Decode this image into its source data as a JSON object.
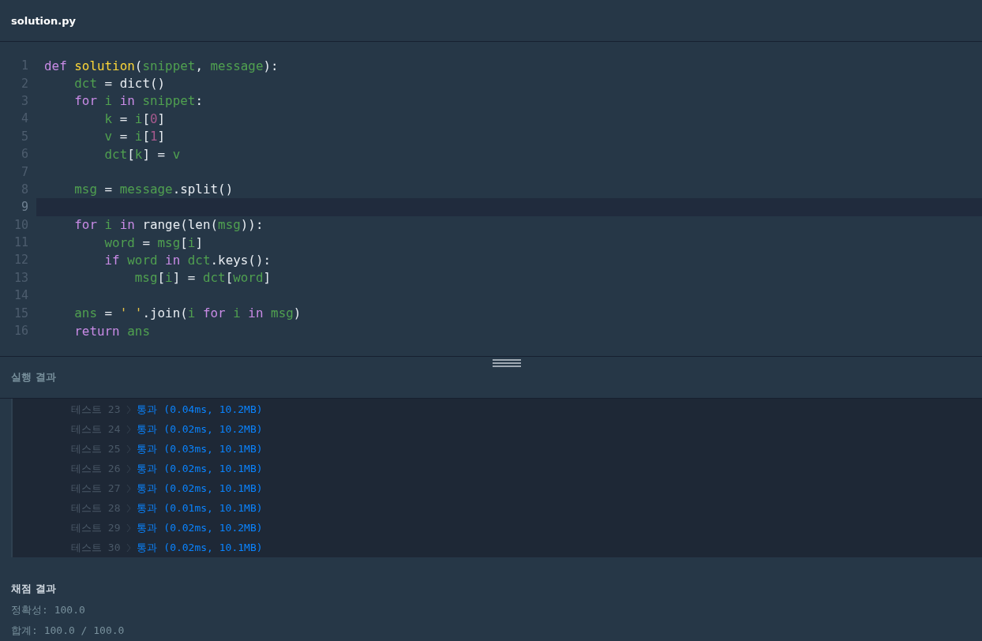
{
  "file_tab": {
    "title": "solution.py"
  },
  "code": {
    "lines": [
      {
        "number": "1",
        "highlighted": false,
        "tokens": [
          {
            "kind": "kw",
            "text": "def "
          },
          {
            "kind": "fn",
            "text": "solution"
          },
          {
            "kind": "plain",
            "text": "("
          },
          {
            "kind": "var",
            "text": "snippet"
          },
          {
            "kind": "plain",
            "text": ", "
          },
          {
            "kind": "var",
            "text": "message"
          },
          {
            "kind": "plain",
            "text": "):"
          }
        ]
      },
      {
        "number": "2",
        "highlighted": false,
        "tokens": [
          {
            "kind": "var",
            "text": "    dct"
          },
          {
            "kind": "plain",
            "text": " = dict()"
          }
        ]
      },
      {
        "number": "3",
        "highlighted": false,
        "tokens": [
          {
            "kind": "kw",
            "text": "    for "
          },
          {
            "kind": "var",
            "text": "i "
          },
          {
            "kind": "kw",
            "text": "in "
          },
          {
            "kind": "var",
            "text": "snippet"
          },
          {
            "kind": "plain",
            "text": ":"
          }
        ]
      },
      {
        "number": "4",
        "highlighted": false,
        "tokens": [
          {
            "kind": "var",
            "text": "        k"
          },
          {
            "kind": "plain",
            "text": " = "
          },
          {
            "kind": "var",
            "text": "i"
          },
          {
            "kind": "plain",
            "text": "["
          },
          {
            "kind": "num",
            "text": "0"
          },
          {
            "kind": "plain",
            "text": "]"
          }
        ]
      },
      {
        "number": "5",
        "highlighted": false,
        "tokens": [
          {
            "kind": "var",
            "text": "        v"
          },
          {
            "kind": "plain",
            "text": " = "
          },
          {
            "kind": "var",
            "text": "i"
          },
          {
            "kind": "plain",
            "text": "["
          },
          {
            "kind": "num",
            "text": "1"
          },
          {
            "kind": "plain",
            "text": "]"
          }
        ]
      },
      {
        "number": "6",
        "highlighted": false,
        "tokens": [
          {
            "kind": "var",
            "text": "        dct"
          },
          {
            "kind": "plain",
            "text": "["
          },
          {
            "kind": "var",
            "text": "k"
          },
          {
            "kind": "plain",
            "text": "] = "
          },
          {
            "kind": "var",
            "text": "v"
          }
        ]
      },
      {
        "number": "7",
        "highlighted": false
      },
      {
        "number": "8",
        "highlighted": false,
        "tokens": [
          {
            "kind": "var",
            "text": "    msg"
          },
          {
            "kind": "plain",
            "text": " = "
          },
          {
            "kind": "var",
            "text": "message"
          },
          {
            "kind": "plain",
            "text": ".split()"
          }
        ]
      },
      {
        "number": "9",
        "highlighted": true
      },
      {
        "number": "10",
        "highlighted": false,
        "tokens": [
          {
            "kind": "kw",
            "text": "    for "
          },
          {
            "kind": "var",
            "text": "i "
          },
          {
            "kind": "kw",
            "text": "in "
          },
          {
            "kind": "plain",
            "text": "range(len("
          },
          {
            "kind": "var",
            "text": "msg"
          },
          {
            "kind": "plain",
            "text": ")):"
          }
        ]
      },
      {
        "number": "11",
        "highlighted": false,
        "tokens": [
          {
            "kind": "var",
            "text": "        word"
          },
          {
            "kind": "plain",
            "text": " = "
          },
          {
            "kind": "var",
            "text": "msg"
          },
          {
            "kind": "plain",
            "text": "["
          },
          {
            "kind": "var",
            "text": "i"
          },
          {
            "kind": "plain",
            "text": "]"
          }
        ]
      },
      {
        "number": "12",
        "highlighted": false,
        "tokens": [
          {
            "kind": "kw",
            "text": "        if "
          },
          {
            "kind": "var",
            "text": "word "
          },
          {
            "kind": "kw",
            "text": "in "
          },
          {
            "kind": "var",
            "text": "dct"
          },
          {
            "kind": "plain",
            "text": ".keys():"
          }
        ]
      },
      {
        "number": "13",
        "highlighted": false,
        "tokens": [
          {
            "kind": "var",
            "text": "            msg"
          },
          {
            "kind": "plain",
            "text": "["
          },
          {
            "kind": "var",
            "text": "i"
          },
          {
            "kind": "plain",
            "text": "] = "
          },
          {
            "kind": "var",
            "text": "dct"
          },
          {
            "kind": "plain",
            "text": "["
          },
          {
            "kind": "var",
            "text": "word"
          },
          {
            "kind": "plain",
            "text": "]"
          }
        ]
      },
      {
        "number": "14",
        "highlighted": false
      },
      {
        "number": "15",
        "highlighted": false,
        "tokens": [
          {
            "kind": "var",
            "text": "    ans"
          },
          {
            "kind": "plain",
            "text": " = "
          },
          {
            "kind": "str",
            "text": "' '"
          },
          {
            "kind": "plain",
            "text": ".join("
          },
          {
            "kind": "var",
            "text": "i "
          },
          {
            "kind": "kw",
            "text": "for "
          },
          {
            "kind": "var",
            "text": "i "
          },
          {
            "kind": "kw",
            "text": "in "
          },
          {
            "kind": "var",
            "text": "msg"
          },
          {
            "kind": "plain",
            "text": ")"
          }
        ]
      },
      {
        "number": "16",
        "highlighted": false,
        "tokens": [
          {
            "kind": "kw",
            "text": "    return "
          },
          {
            "kind": "var",
            "text": "ans"
          }
        ]
      }
    ]
  },
  "run_results": {
    "title": "실행 결과",
    "tests": [
      {
        "label": "테스트 23",
        "result": "통과 (0.04ms, 10.2MB)"
      },
      {
        "label": "테스트 24",
        "result": "통과 (0.02ms, 10.2MB)"
      },
      {
        "label": "테스트 25",
        "result": "통과 (0.03ms, 10.1MB)"
      },
      {
        "label": "테스트 26",
        "result": "통과 (0.02ms, 10.1MB)"
      },
      {
        "label": "테스트 27",
        "result": "통과 (0.02ms, 10.1MB)"
      },
      {
        "label": "테스트 28",
        "result": "통과 (0.01ms, 10.1MB)"
      },
      {
        "label": "테스트 29",
        "result": "통과 (0.02ms, 10.2MB)"
      },
      {
        "label": "테스트 30",
        "result": "통과 (0.02ms, 10.1MB)"
      }
    ]
  },
  "grading": {
    "title": "채점 결과",
    "accuracy": "정확성: 100.0",
    "total": "합계: 100.0 / 100.0"
  }
}
